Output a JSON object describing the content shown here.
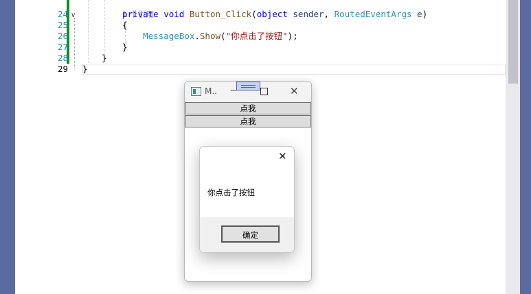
{
  "editor": {
    "reference_hint": "1 个引用",
    "lines": [
      {
        "num": "24",
        "tokens": [
          [
            "kw",
            "private"
          ],
          [
            "pl",
            " "
          ],
          [
            "kw",
            "void"
          ],
          [
            "pl",
            " "
          ],
          [
            "fn",
            "Button_Click"
          ],
          [
            "pl",
            "("
          ],
          [
            "kw",
            "object"
          ],
          [
            "pl",
            " "
          ],
          [
            "pm",
            "sender"
          ],
          [
            "pl",
            ", "
          ],
          [
            "ty",
            "RoutedEventArgs"
          ],
          [
            "pl",
            " "
          ],
          [
            "pm",
            "e"
          ],
          [
            "pl",
            ")"
          ]
        ]
      },
      {
        "num": "25",
        "tokens": [
          [
            "pl",
            "{"
          ]
        ]
      },
      {
        "num": "26",
        "tokens": [
          [
            "pl",
            "    "
          ],
          [
            "ty",
            "MessageBox"
          ],
          [
            "pl",
            "."
          ],
          [
            "fn",
            "Show"
          ],
          [
            "pl",
            "("
          ],
          [
            "st",
            "\"你点击了按钮\""
          ],
          [
            "pl",
            ");"
          ]
        ]
      },
      {
        "num": "27",
        "tokens": [
          [
            "pl",
            "}"
          ]
        ]
      },
      {
        "num": "28",
        "tokens": [
          [
            "pl",
            "}"
          ]
        ]
      },
      {
        "num": "29",
        "tokens": [
          [
            "pl",
            "}"
          ]
        ]
      }
    ]
  },
  "app_window": {
    "title": "M..",
    "buttons": [
      "点我",
      "点我"
    ]
  },
  "message_box": {
    "text": "你点击了按钮",
    "ok_label": "确定"
  }
}
